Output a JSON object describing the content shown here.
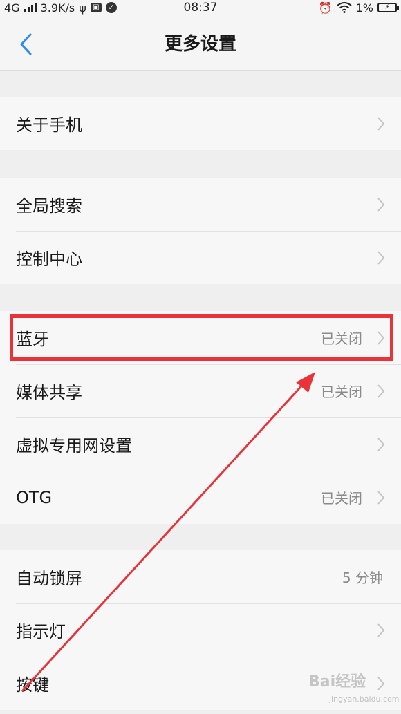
{
  "status_bar": {
    "network": "4G",
    "speed": "3.9K/s",
    "time": "08:37",
    "battery": "1%"
  },
  "header": {
    "title": "更多设置"
  },
  "sections": [
    {
      "rows": [
        {
          "label": "关于手机",
          "value": ""
        }
      ]
    },
    {
      "rows": [
        {
          "label": "全局搜索",
          "value": ""
        },
        {
          "label": "控制中心",
          "value": ""
        }
      ]
    },
    {
      "rows": [
        {
          "label": "蓝牙",
          "value": "已关闭"
        },
        {
          "label": "媒体共享",
          "value": "已关闭"
        },
        {
          "label": "虚拟专用网设置",
          "value": ""
        },
        {
          "label": "OTG",
          "value": "已关闭"
        }
      ]
    },
    {
      "rows": [
        {
          "label": "自动锁屏",
          "value": "5 分钟"
        },
        {
          "label": "指示灯",
          "value": ""
        },
        {
          "label": "按键",
          "value": ""
        }
      ]
    }
  ],
  "watermark": {
    "brand": "Bai经验",
    "domain": "jingyan.baidu.com"
  },
  "colors": {
    "accent": "#2a8af6",
    "highlight": "#e8333a"
  }
}
